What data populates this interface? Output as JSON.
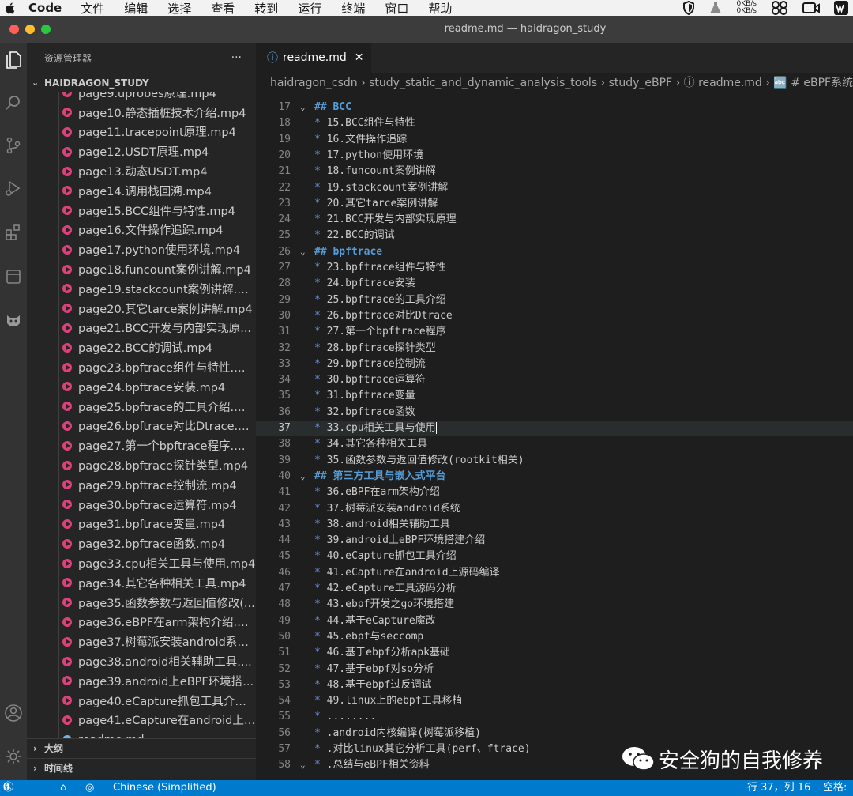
{
  "menubar": {
    "app_name": "Code",
    "items": [
      "文件",
      "编辑",
      "选择",
      "查看",
      "转到",
      "运行",
      "终端",
      "窗口",
      "帮助"
    ],
    "net_up": "0KB/s",
    "net_down": "0KB/s"
  },
  "window": {
    "title": "readme.md — haidragon_study"
  },
  "sidebar": {
    "header": "资源管理器",
    "more": "···",
    "root": "HAIDRAGON_STUDY",
    "files": [
      "page9.uprobes原理.mp4",
      "page10.静态插桩技术介绍.mp4",
      "page11.tracepoint原理.mp4",
      "page12.USDT原理.mp4",
      "page13.动态USDT.mp4",
      "page14.调用栈回溯.mp4",
      "page15.BCC组件与特性.mp4",
      "page16.文件操作追踪.mp4",
      "page17.python使用环境.mp4",
      "page18.funcount案例讲解.mp4",
      "page19.stackcount案例讲解.mp4",
      "page20.其它tarce案例讲解.mp4",
      "page21.BCC开发与内部实现原...",
      "page22.BCC的调试.mp4",
      "page23.bpftrace组件与特性.mp4",
      "page24.bpftrace安装.mp4",
      "page25.bpftrace的工具介绍.mp4",
      "page26.bpftrace对比Dtrace.mp4",
      "page27.第一个bpftrace程序.mp4",
      "page28.bpftrace探针类型.mp4",
      "page29.bpftrace控制流.mp4",
      "page30.bpftrace运算符.mp4",
      "page31.bpftrace变量.mp4",
      "page32.bpftrace函数.mp4",
      "page33.cpu相关工具与使用.mp4",
      "page34.其它各种相关工具.mp4",
      "page35.函数参数与返回值修改(...",
      "page36.eBPF在arm架构介绍.m...",
      "page37.树莓派安装android系统....",
      "page38.android相关辅助工具....",
      "page39.android上eBPF环境搭...",
      "page40.eCapture抓包工具介绍....",
      "page41.eCapture在android上源...",
      "readme.md"
    ],
    "outline": "大纲",
    "timeline": "时间线"
  },
  "editor": {
    "tab_label": "readme.md",
    "breadcrumb": "haidragon_csdn  ›  study_static_and_dynamic_analysis_tools  ›  study_eBPF  ›  ⓘ readme.md  ›  🔤 # eBPF系统",
    "lines": [
      {
        "n": "17",
        "fold": "⌄",
        "kind": "heading",
        "text": "## BCC"
      },
      {
        "n": "18",
        "kind": "item",
        "text": "15.BCC组件与特性"
      },
      {
        "n": "19",
        "kind": "item",
        "text": "16.文件操作追踪"
      },
      {
        "n": "20",
        "kind": "item",
        "text": "17.python使用环境"
      },
      {
        "n": "21",
        "kind": "item",
        "text": "18.funcount案例讲解"
      },
      {
        "n": "22",
        "kind": "item",
        "text": "19.stackcount案例讲解"
      },
      {
        "n": "23",
        "kind": "item",
        "text": "20.其它tarce案例讲解"
      },
      {
        "n": "24",
        "kind": "item",
        "text": "21.BCC开发与内部实现原理"
      },
      {
        "n": "25",
        "kind": "item",
        "text": "22.BCC的调试"
      },
      {
        "n": "26",
        "fold": "⌄",
        "kind": "heading",
        "text": "## bpftrace"
      },
      {
        "n": "27",
        "kind": "item",
        "text": "23.bpftrace组件与特性"
      },
      {
        "n": "28",
        "kind": "item",
        "text": "24.bpftrace安装"
      },
      {
        "n": "29",
        "kind": "item",
        "text": "25.bpftrace的工具介绍"
      },
      {
        "n": "30",
        "kind": "item",
        "text": "26.bpftrace对比Dtrace"
      },
      {
        "n": "31",
        "kind": "item",
        "text": "27.第一个bpftrace程序"
      },
      {
        "n": "32",
        "kind": "item",
        "text": "28.bpftrace探针类型"
      },
      {
        "n": "33",
        "kind": "item",
        "text": "29.bpftrace控制流"
      },
      {
        "n": "34",
        "kind": "item",
        "text": "30.bpftrace运算符"
      },
      {
        "n": "35",
        "kind": "item",
        "text": "31.bpftrace变量"
      },
      {
        "n": "36",
        "kind": "item",
        "text": "32.bpftrace函数"
      },
      {
        "n": "37",
        "kind": "item",
        "text": "33.cpu相关工具与使用",
        "current": true
      },
      {
        "n": "38",
        "kind": "item",
        "text": "34.其它各种相关工具"
      },
      {
        "n": "39",
        "kind": "item",
        "text": "35.函数参数与返回值修改(rootkit相关)"
      },
      {
        "n": "40",
        "fold": "⌄",
        "kind": "heading",
        "text": "## 第三方工具与嵌入式平台"
      },
      {
        "n": "41",
        "kind": "item",
        "text": "36.eBPF在arm架构介绍"
      },
      {
        "n": "42",
        "kind": "item",
        "text": "37.树莓派安装android系统"
      },
      {
        "n": "43",
        "kind": "item",
        "text": "38.android相关辅助工具"
      },
      {
        "n": "44",
        "kind": "item",
        "text": "39.android上eBPF环境搭建介绍"
      },
      {
        "n": "45",
        "kind": "item",
        "text": "40.eCapture抓包工具介绍"
      },
      {
        "n": "46",
        "kind": "item",
        "text": "41.eCapture在android上源码编译"
      },
      {
        "n": "47",
        "kind": "item",
        "text": "42.eCapture工具源码分析"
      },
      {
        "n": "48",
        "kind": "item",
        "text": "43.ebpf开发之go环境搭建"
      },
      {
        "n": "49",
        "kind": "item",
        "text": "44.基于eCapture魔改"
      },
      {
        "n": "50",
        "kind": "item",
        "text": "45.ebpf与seccomp"
      },
      {
        "n": "51",
        "kind": "item",
        "text": "46.基于ebpf分析apk基础"
      },
      {
        "n": "52",
        "kind": "item",
        "text": "47.基于ebpf对so分析"
      },
      {
        "n": "53",
        "kind": "item",
        "text": "48.基于ebpf过反调试"
      },
      {
        "n": "54",
        "kind": "item",
        "text": "49.linux上的ebpf工具移植"
      },
      {
        "n": "55",
        "kind": "item",
        "text": "........"
      },
      {
        "n": "56",
        "kind": "item",
        "text": ".android内核编译(树莓派移植)"
      },
      {
        "n": "57",
        "kind": "item",
        "text": ".对比linux其它分析工具(perf、ftrace)"
      },
      {
        "n": "58",
        "fold": "⌄",
        "kind": "item",
        "text": ".总结与eBPF相关资料"
      }
    ]
  },
  "statusbar": {
    "errors": "0",
    "warnings": "0",
    "language": "Chinese (Simplified)",
    "position": "行 37，列 16",
    "indent": "空格:"
  },
  "watermark": "安全狗的自我修养",
  "colors": {
    "accent": "#007acc",
    "file_icon": "#e0407a",
    "heading": "#569cd6"
  }
}
